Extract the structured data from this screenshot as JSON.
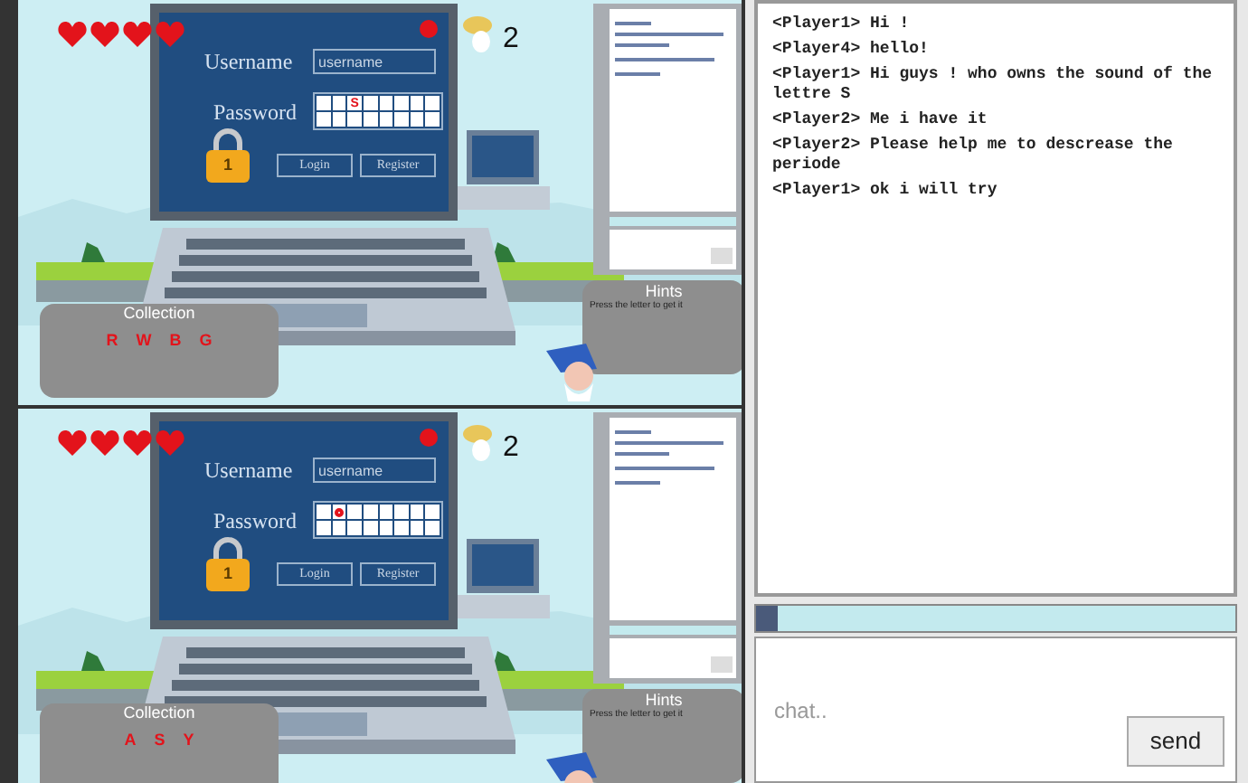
{
  "game_views": [
    {
      "hearts": [
        {
          "kind": "full"
        },
        {
          "kind": "full"
        },
        {
          "kind": "full"
        },
        {
          "kind": "full"
        }
      ],
      "username_label": "Username",
      "username_field": {
        "placeholder": "username"
      },
      "password_label": "Password",
      "password_slots": [
        {
          "kind": "empty"
        },
        {
          "kind": "empty"
        },
        {
          "kind": "letter",
          "text": "S"
        },
        {
          "kind": "empty"
        },
        {
          "kind": "empty"
        },
        {
          "kind": "empty"
        },
        {
          "kind": "empty"
        },
        {
          "kind": "empty"
        },
        {
          "kind": "empty"
        },
        {
          "kind": "empty"
        },
        {
          "kind": "empty"
        },
        {
          "kind": "empty"
        },
        {
          "kind": "empty"
        },
        {
          "kind": "empty"
        },
        {
          "kind": "empty"
        },
        {
          "kind": "empty"
        }
      ],
      "lock_number": "1",
      "buttons": [
        "Login",
        "Register"
      ],
      "coins": "2",
      "hints": {
        "title": "Hints",
        "text": "Press the letter to get it"
      },
      "collection": {
        "title": "Collection",
        "letters": [
          "R",
          "W",
          "B",
          "G"
        ]
      }
    },
    {
      "hearts": [
        {
          "kind": "full"
        },
        {
          "kind": "full"
        },
        {
          "kind": "full"
        },
        {
          "kind": "full"
        }
      ],
      "username_label": "Username",
      "username_field": {
        "placeholder": "username"
      },
      "password_label": "Password",
      "password_slots": [
        {
          "kind": "empty"
        },
        {
          "kind": "mark"
        },
        {
          "kind": "empty"
        },
        {
          "kind": "empty"
        },
        {
          "kind": "empty"
        },
        {
          "kind": "empty"
        },
        {
          "kind": "empty"
        },
        {
          "kind": "empty"
        },
        {
          "kind": "empty"
        },
        {
          "kind": "empty"
        },
        {
          "kind": "empty"
        },
        {
          "kind": "empty"
        },
        {
          "kind": "empty"
        },
        {
          "kind": "empty"
        },
        {
          "kind": "empty"
        },
        {
          "kind": "empty"
        }
      ],
      "lock_number": "1",
      "buttons": [
        "Login",
        "Register"
      ],
      "coins": "2",
      "hints": {
        "title": "Hints",
        "text": "Press the letter to get it"
      },
      "collection": {
        "title": "Collection",
        "letters": [
          "A",
          "S",
          "Y"
        ]
      }
    }
  ],
  "chat": {
    "messages": [
      {
        "sender": "<Player1>",
        "text": "Hi !"
      },
      {
        "sender": "<Player4>",
        "text": "hello!"
      },
      {
        "sender": "<Player1>",
        "text": "Hi guys ! who owns the sound of the lettre S"
      },
      {
        "sender": "<Player2>",
        "text": "Me i have it"
      },
      {
        "sender": "<Player2>",
        "text": "Please help me to descrease the periode"
      },
      {
        "sender": "<Player1>",
        "text": "ok i will try"
      }
    ],
    "input": {
      "placeholder": "chat.."
    },
    "send_button": "send"
  }
}
